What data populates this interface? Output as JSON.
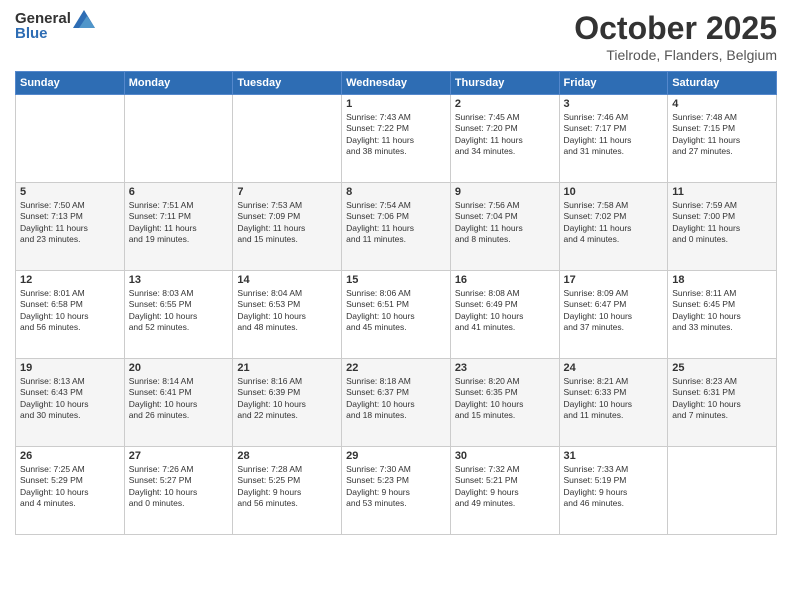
{
  "header": {
    "logo_general": "General",
    "logo_blue": "Blue",
    "month": "October 2025",
    "location": "Tielrode, Flanders, Belgium"
  },
  "weekdays": [
    "Sunday",
    "Monday",
    "Tuesday",
    "Wednesday",
    "Thursday",
    "Friday",
    "Saturday"
  ],
  "weeks": [
    [
      {
        "day": "",
        "info": ""
      },
      {
        "day": "",
        "info": ""
      },
      {
        "day": "",
        "info": ""
      },
      {
        "day": "1",
        "info": "Sunrise: 7:43 AM\nSunset: 7:22 PM\nDaylight: 11 hours\nand 38 minutes."
      },
      {
        "day": "2",
        "info": "Sunrise: 7:45 AM\nSunset: 7:20 PM\nDaylight: 11 hours\nand 34 minutes."
      },
      {
        "day": "3",
        "info": "Sunrise: 7:46 AM\nSunset: 7:17 PM\nDaylight: 11 hours\nand 31 minutes."
      },
      {
        "day": "4",
        "info": "Sunrise: 7:48 AM\nSunset: 7:15 PM\nDaylight: 11 hours\nand 27 minutes."
      }
    ],
    [
      {
        "day": "5",
        "info": "Sunrise: 7:50 AM\nSunset: 7:13 PM\nDaylight: 11 hours\nand 23 minutes."
      },
      {
        "day": "6",
        "info": "Sunrise: 7:51 AM\nSunset: 7:11 PM\nDaylight: 11 hours\nand 19 minutes."
      },
      {
        "day": "7",
        "info": "Sunrise: 7:53 AM\nSunset: 7:09 PM\nDaylight: 11 hours\nand 15 minutes."
      },
      {
        "day": "8",
        "info": "Sunrise: 7:54 AM\nSunset: 7:06 PM\nDaylight: 11 hours\nand 11 minutes."
      },
      {
        "day": "9",
        "info": "Sunrise: 7:56 AM\nSunset: 7:04 PM\nDaylight: 11 hours\nand 8 minutes."
      },
      {
        "day": "10",
        "info": "Sunrise: 7:58 AM\nSunset: 7:02 PM\nDaylight: 11 hours\nand 4 minutes."
      },
      {
        "day": "11",
        "info": "Sunrise: 7:59 AM\nSunset: 7:00 PM\nDaylight: 11 hours\nand 0 minutes."
      }
    ],
    [
      {
        "day": "12",
        "info": "Sunrise: 8:01 AM\nSunset: 6:58 PM\nDaylight: 10 hours\nand 56 minutes."
      },
      {
        "day": "13",
        "info": "Sunrise: 8:03 AM\nSunset: 6:55 PM\nDaylight: 10 hours\nand 52 minutes."
      },
      {
        "day": "14",
        "info": "Sunrise: 8:04 AM\nSunset: 6:53 PM\nDaylight: 10 hours\nand 48 minutes."
      },
      {
        "day": "15",
        "info": "Sunrise: 8:06 AM\nSunset: 6:51 PM\nDaylight: 10 hours\nand 45 minutes."
      },
      {
        "day": "16",
        "info": "Sunrise: 8:08 AM\nSunset: 6:49 PM\nDaylight: 10 hours\nand 41 minutes."
      },
      {
        "day": "17",
        "info": "Sunrise: 8:09 AM\nSunset: 6:47 PM\nDaylight: 10 hours\nand 37 minutes."
      },
      {
        "day": "18",
        "info": "Sunrise: 8:11 AM\nSunset: 6:45 PM\nDaylight: 10 hours\nand 33 minutes."
      }
    ],
    [
      {
        "day": "19",
        "info": "Sunrise: 8:13 AM\nSunset: 6:43 PM\nDaylight: 10 hours\nand 30 minutes."
      },
      {
        "day": "20",
        "info": "Sunrise: 8:14 AM\nSunset: 6:41 PM\nDaylight: 10 hours\nand 26 minutes."
      },
      {
        "day": "21",
        "info": "Sunrise: 8:16 AM\nSunset: 6:39 PM\nDaylight: 10 hours\nand 22 minutes."
      },
      {
        "day": "22",
        "info": "Sunrise: 8:18 AM\nSunset: 6:37 PM\nDaylight: 10 hours\nand 18 minutes."
      },
      {
        "day": "23",
        "info": "Sunrise: 8:20 AM\nSunset: 6:35 PM\nDaylight: 10 hours\nand 15 minutes."
      },
      {
        "day": "24",
        "info": "Sunrise: 8:21 AM\nSunset: 6:33 PM\nDaylight: 10 hours\nand 11 minutes."
      },
      {
        "day": "25",
        "info": "Sunrise: 8:23 AM\nSunset: 6:31 PM\nDaylight: 10 hours\nand 7 minutes."
      }
    ],
    [
      {
        "day": "26",
        "info": "Sunrise: 7:25 AM\nSunset: 5:29 PM\nDaylight: 10 hours\nand 4 minutes."
      },
      {
        "day": "27",
        "info": "Sunrise: 7:26 AM\nSunset: 5:27 PM\nDaylight: 10 hours\nand 0 minutes."
      },
      {
        "day": "28",
        "info": "Sunrise: 7:28 AM\nSunset: 5:25 PM\nDaylight: 9 hours\nand 56 minutes."
      },
      {
        "day": "29",
        "info": "Sunrise: 7:30 AM\nSunset: 5:23 PM\nDaylight: 9 hours\nand 53 minutes."
      },
      {
        "day": "30",
        "info": "Sunrise: 7:32 AM\nSunset: 5:21 PM\nDaylight: 9 hours\nand 49 minutes."
      },
      {
        "day": "31",
        "info": "Sunrise: 7:33 AM\nSunset: 5:19 PM\nDaylight: 9 hours\nand 46 minutes."
      },
      {
        "day": "",
        "info": ""
      }
    ]
  ]
}
